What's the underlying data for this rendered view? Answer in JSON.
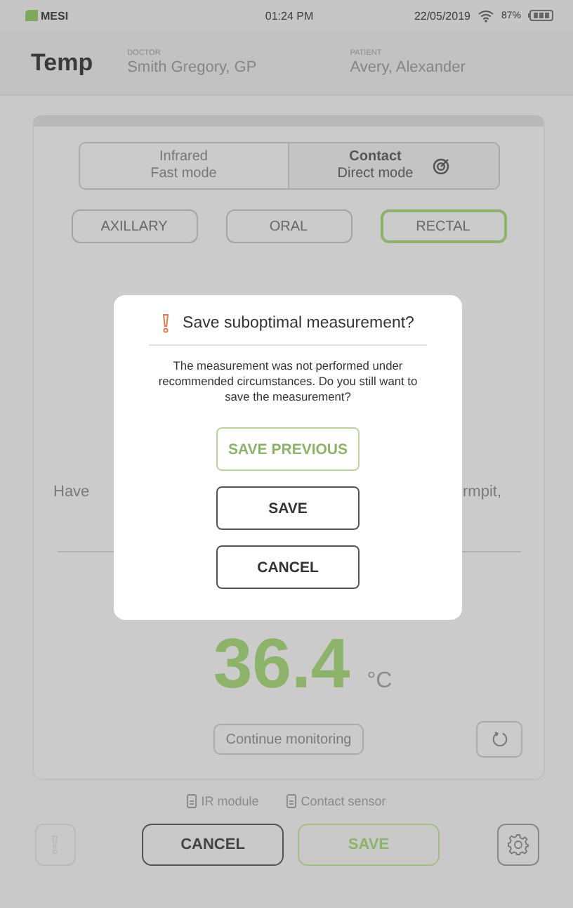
{
  "status_bar": {
    "brand": "MESI",
    "time": "01:24 PM",
    "date": "22/05/2019",
    "battery": "87%"
  },
  "header": {
    "title": "Temp",
    "fields": [
      {
        "label": "DOCTOR",
        "value": "Smith Gregory, GP"
      },
      {
        "label": "PATIENT",
        "value": "Avery, Alexander"
      }
    ]
  },
  "modes": [
    {
      "name": "Infrared",
      "sub": "Fast mode",
      "selected": false
    },
    {
      "name": "Contact",
      "sub": "Direct mode",
      "selected": true
    }
  ],
  "sites": [
    {
      "label": "AXILLARY",
      "selected": false
    },
    {
      "label": "ORAL",
      "selected": false
    },
    {
      "label": "RECTAL",
      "selected": true
    }
  ],
  "hint_fragments": [
    "Have",
    "rmpit,"
  ],
  "reading": {
    "value": "36.4",
    "unit": "°C"
  },
  "continue_button": "Continue monitoring",
  "sensors": [
    "IR module",
    "Contact sensor"
  ],
  "actions": [
    {
      "label": "CANCEL",
      "kind": "plain"
    },
    {
      "label": "SAVE",
      "kind": "primary"
    }
  ],
  "dialog": {
    "title": "Save suboptimal measurement?",
    "message": "The measurement was not performed under recommended circumstances. Do you still want to save the measurement?",
    "buttons": [
      {
        "label": "SAVE PREVIOUS",
        "kind": "primary"
      },
      {
        "label": "SAVE",
        "kind": "plain"
      },
      {
        "label": "CANCEL",
        "kind": "plain"
      }
    ]
  }
}
